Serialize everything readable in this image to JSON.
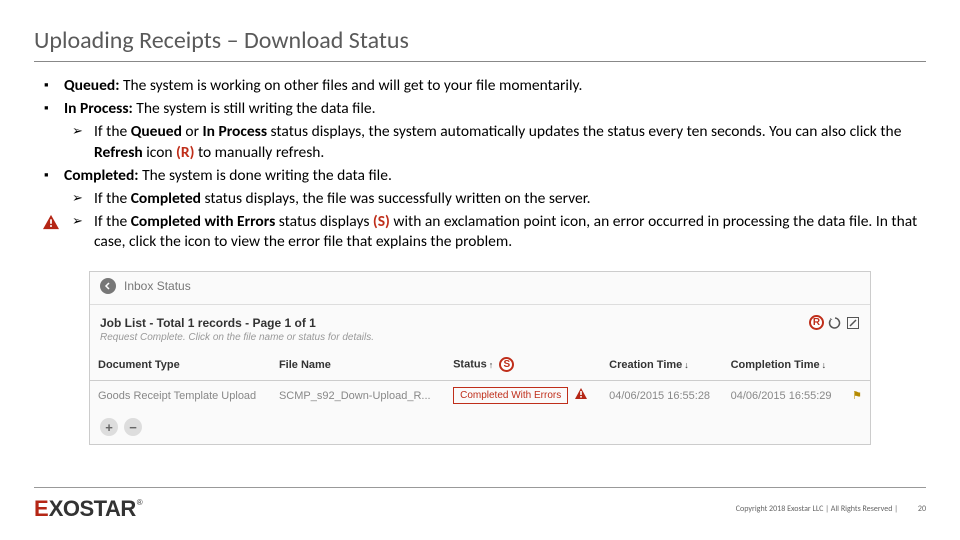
{
  "title": "Uploading Receipts – Download Status",
  "bullets": {
    "queued_label": "Queued:",
    "queued_text": " The system is working on other files and will get to your file momentarily.",
    "inprocess_label": "In Process:",
    "inprocess_text": " The system is still writing the data file.",
    "inprocess_sub_a": "If the ",
    "inprocess_sub_b": "Queued",
    "inprocess_sub_c": " or ",
    "inprocess_sub_d": "In Process",
    "inprocess_sub_e": " status displays, the system automatically updates the status every ten seconds. You can also click the ",
    "inprocess_sub_f": "Refresh",
    "inprocess_sub_g": " icon ",
    "inprocess_sub_r": "(R)",
    "inprocess_sub_h": " to manually refresh.",
    "completed_label": "Completed:",
    "completed_text": " The system is done writing the data file.",
    "completed_sub1_a": "If the ",
    "completed_sub1_b": "Completed",
    "completed_sub1_c": " status displays, the file was successfully written on the server.",
    "completed_sub2_a": "If the ",
    "completed_sub2_b": "Completed with Errors",
    "completed_sub2_c": " status displays ",
    "completed_sub2_s": "(S)",
    "completed_sub2_d": " with an exclamation point icon, an error occurred in processing the data file. In that case, click the icon to view the error file that explains the problem."
  },
  "screenshot": {
    "header": "Inbox Status",
    "joblist": "Job List - Total 1 records - Page 1 of 1",
    "sub": "Request Complete. Click on the file name or status for details.",
    "r_label": "R",
    "s_label": "S",
    "cols": {
      "doctype": "Document Type",
      "filename": "File Name",
      "status": "Status",
      "creation": "Creation Time",
      "completion": "Completion Time"
    },
    "row": {
      "doctype": "Goods Receipt Template Upload",
      "filename": "SCMP_s92_Down-Upload_R...",
      "status": "Completed With Errors",
      "creation": "04/06/2015 16:55:28",
      "completion": "04/06/2015 16:55:29"
    },
    "plus": "+",
    "minus": "−"
  },
  "footer": {
    "copyright": "Copyright 2018 Exostar LLC | All Rights Reserved |",
    "page": "20",
    "logo_e": "E",
    "logo_rest": "XOSTAR",
    "logo_r": "®"
  }
}
